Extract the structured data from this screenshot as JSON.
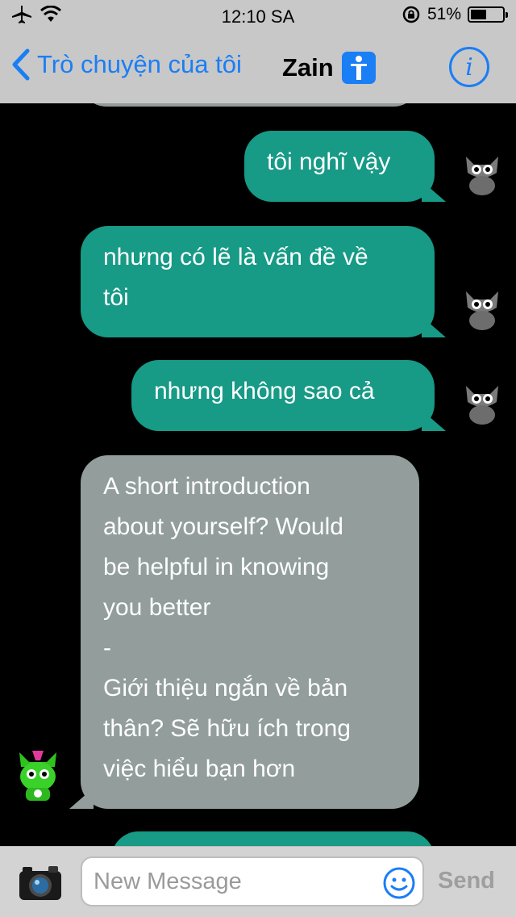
{
  "status_bar": {
    "time": "12:10 SA",
    "battery_percent": "51%",
    "battery_level": 0.51
  },
  "nav": {
    "back_label": "Trò chuyện của tôi",
    "title": "Zain",
    "info_icon": "info-circle-icon"
  },
  "messages": [
    {
      "direction": "outgoing",
      "text": "tôi nghĩ vậy"
    },
    {
      "direction": "outgoing",
      "line1": "nhưng có lẽ là vấn đề về",
      "line2": "tôi"
    },
    {
      "direction": "outgoing",
      "text": "nhưng không sao cả"
    },
    {
      "direction": "incoming",
      "lines": [
        "A short introduction",
        "about yourself? Would",
        "be helpful in knowing",
        "you better",
        "-",
        "Giới thiệu ngắn về bản",
        "thân? Sẽ hữu ích trong",
        "việc hiểu bạn hơn"
      ]
    }
  ],
  "composer": {
    "placeholder": "New Message",
    "send_label": "Send",
    "camera_icon": "camera-icon",
    "emoji_icon": "emoji-icon"
  },
  "colors": {
    "outgoing_bubble": "#179a86",
    "incoming_bubble": "#929d9c",
    "accent": "#1a7ef5",
    "background": "#000000"
  }
}
